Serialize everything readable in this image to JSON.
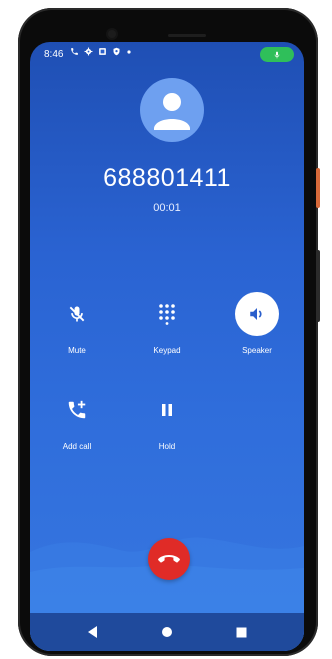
{
  "status_bar": {
    "time": "8:46",
    "icons": [
      "phone-icon",
      "gear-icon",
      "card-icon",
      "shield-icon",
      "dot-icon"
    ],
    "mic_indicator": "mic-icon"
  },
  "call": {
    "number": "688801411",
    "duration": "00:01"
  },
  "controls": {
    "mute_label": "Mute",
    "keypad_label": "Keypad",
    "speaker_label": "Speaker",
    "add_call_label": "Add call",
    "hold_label": "Hold"
  },
  "colors": {
    "background_top": "#1f4fb4",
    "background_bottom": "#3777e0",
    "end_call": "#e02b27",
    "mic_indicator": "#2fbf5a",
    "avatar": "#6ea0f0"
  }
}
